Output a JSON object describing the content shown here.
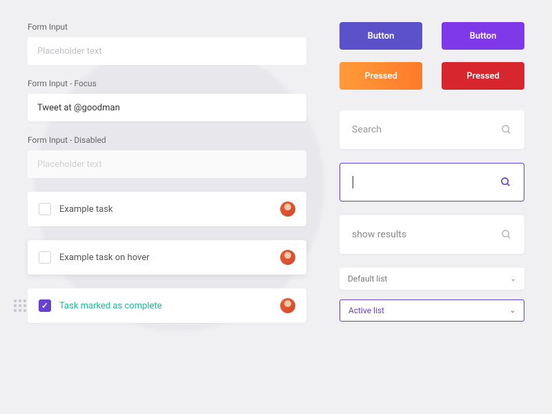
{
  "inputs": {
    "normal": {
      "label": "Form Input",
      "placeholder": "Placeholder text"
    },
    "focus": {
      "label": "Form Input - Focus",
      "value": "Tweet at @goodman"
    },
    "disabled": {
      "label": "Form Input - Disabled",
      "placeholder": "Placeholder text"
    }
  },
  "tasks": [
    {
      "text": "Example task"
    },
    {
      "text": "Example task on hover"
    },
    {
      "text": "Task marked as complete"
    }
  ],
  "buttons": {
    "r1c1": "Button",
    "r1c2": "Button",
    "r2c1": "Pressed",
    "r2c2": "Pressed"
  },
  "search": {
    "placeholder1": "Search",
    "placeholder2": "",
    "placeholder3": "show results"
  },
  "selects": {
    "default": "Default list",
    "active": "Active list"
  }
}
